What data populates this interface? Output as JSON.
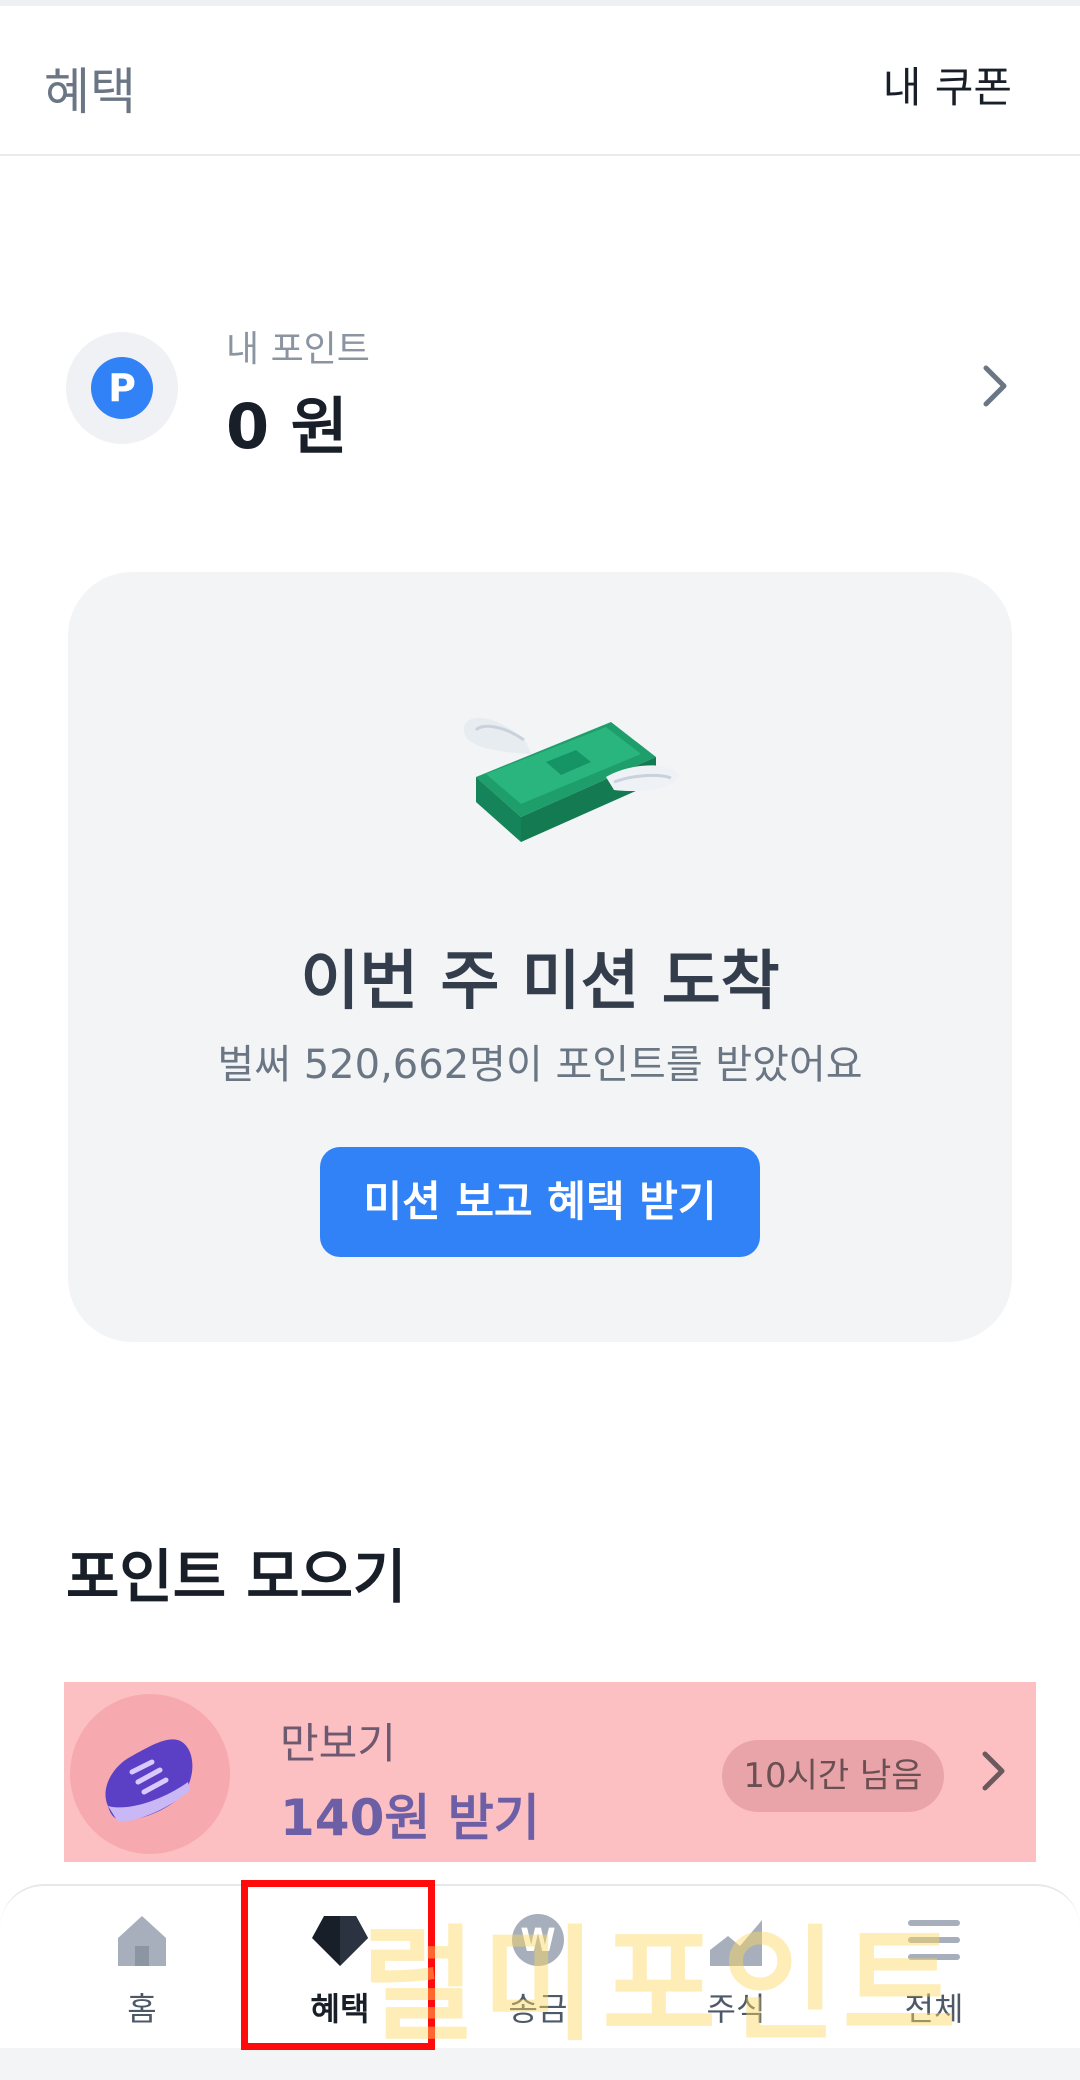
{
  "header": {
    "title": "혜택",
    "coupon_label": "내 쿠폰",
    "large_title": "혜택"
  },
  "points": {
    "badge": "P",
    "label": "내 포인트",
    "value": "0 원"
  },
  "mission": {
    "title": "이번 주 미션 도착",
    "subtitle": "벌써 520,662명이 포인트를 받았어요",
    "button_label": "미션 보고 혜택 받기"
  },
  "collect": {
    "section_title": "포인트 모으기",
    "pedometer": {
      "label": "만보기",
      "reward": "140원 받기",
      "time_left": "10시간 남음"
    }
  },
  "nav": {
    "items": [
      {
        "label": "홈",
        "icon": "home-icon"
      },
      {
        "label": "혜택",
        "icon": "benefit-gem-icon",
        "active": true
      },
      {
        "label": "송금",
        "icon": "won-coin-icon"
      },
      {
        "label": "주식",
        "icon": "stock-chart-icon"
      },
      {
        "label": "전체",
        "icon": "menu-icon"
      }
    ]
  },
  "watermark": {
    "text": "럴미포인트"
  },
  "colors": {
    "accent": "#3182f6",
    "highlight_row": "#fdc0c2",
    "selection_box": "#ff0b0b",
    "card_bg": "#f2f4f6"
  }
}
